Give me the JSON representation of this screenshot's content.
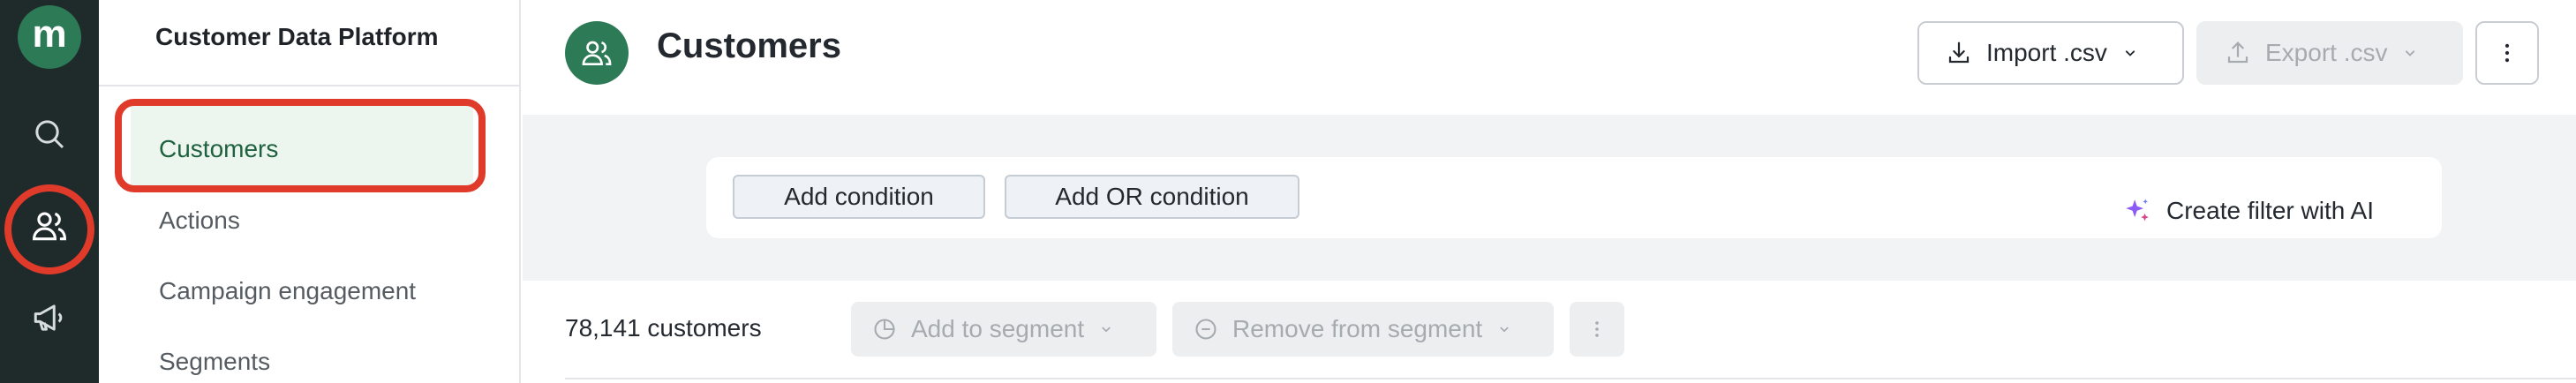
{
  "rail": {
    "logo_letter": "m",
    "items": [
      "search-icon",
      "people-icon",
      "megaphone-icon"
    ]
  },
  "sidebar": {
    "title": "Customer Data Platform",
    "items": [
      {
        "label": "Customers",
        "active": true
      },
      {
        "label": "Actions"
      },
      {
        "label": "Campaign engagement"
      },
      {
        "label": "Segments"
      }
    ]
  },
  "header": {
    "title": "Customers",
    "import_label": "Import .csv",
    "export_label": "Export .csv"
  },
  "filters": {
    "add_condition": "Add condition",
    "add_or_condition": "Add OR condition",
    "ai_label": "Create filter with AI"
  },
  "table": {
    "count": "78,141 customers",
    "add_to_segment": "Add to segment",
    "remove_from_segment": "Remove from segment"
  },
  "colors": {
    "brand": "#2d7a57",
    "rail": "#1f2a2a",
    "highlight": "#e03a2a",
    "ai_accent": "#8b5cf6"
  }
}
